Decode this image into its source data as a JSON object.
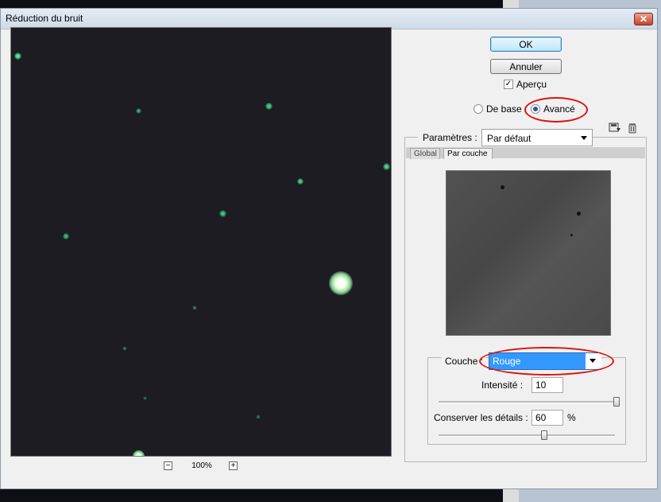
{
  "window": {
    "title": "Réduction du bruit",
    "close_glyph": "✕"
  },
  "preview": {
    "zoom_out": "−",
    "zoom_level": "100%",
    "zoom_in": "+"
  },
  "buttons": {
    "ok": "OK",
    "cancel": "Annuler"
  },
  "preview_toggle": {
    "label": "Aperçu",
    "checked": true
  },
  "mode": {
    "basic_label": "De base",
    "advanced_label": "Avancé",
    "selected": "Avancé"
  },
  "settings": {
    "label": "Paramètres :",
    "value": "Par défaut",
    "save_icon": "save-settings-icon",
    "delete_icon": "trash-icon"
  },
  "tabs": [
    {
      "label": "Global",
      "active": false
    },
    {
      "label": "Par couche",
      "active": true
    }
  ],
  "channel": {
    "label": "Couche :",
    "value": "Rouge",
    "intensity_label": "Intensité :",
    "intensity_value": "10",
    "intensity_max": 10,
    "details_label": "Conserver les détails :",
    "details_value": "60",
    "details_unit": "%",
    "details_percent": 60
  },
  "colors": {
    "highlight_ellipse": "#e01010",
    "selected_select": "#3399ff"
  }
}
